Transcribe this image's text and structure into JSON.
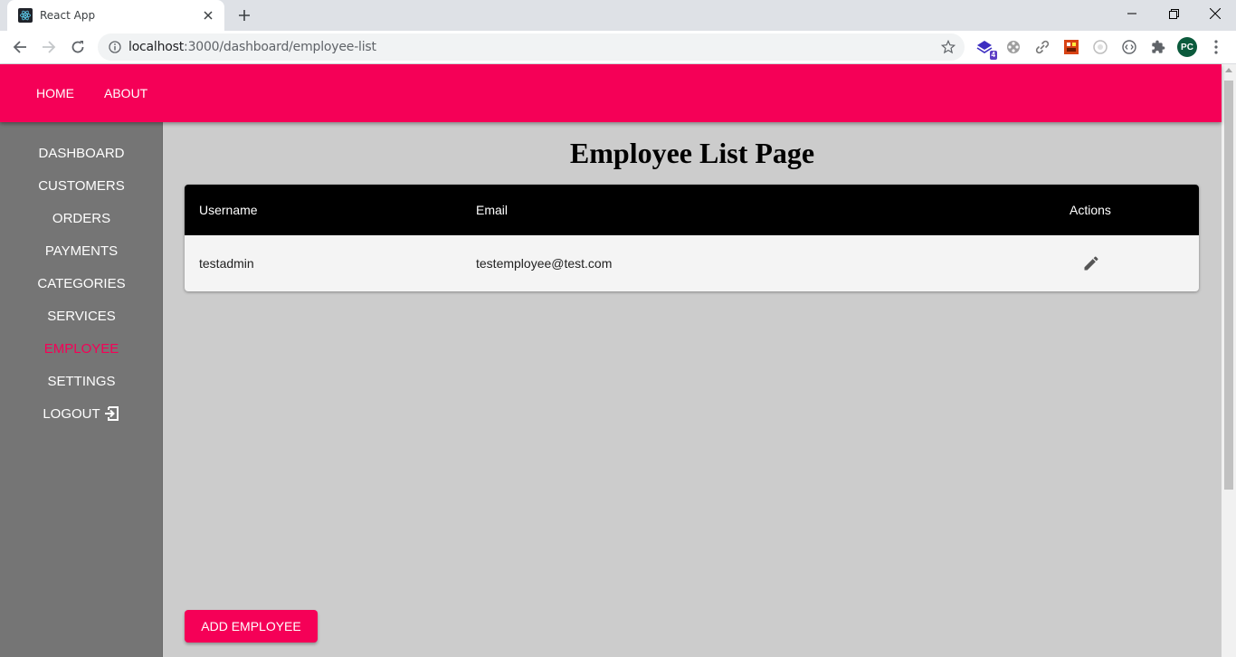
{
  "browser": {
    "tab_title": "React App",
    "url_host": "localhost",
    "url_rest": ":3000/dashboard/employee-list",
    "extension_badge": "4",
    "profile_initials": "PC"
  },
  "appbar": {
    "links": [
      "HOME",
      "ABOUT"
    ]
  },
  "sidebar": {
    "items": [
      {
        "label": "DASHBOARD"
      },
      {
        "label": "CUSTOMERS"
      },
      {
        "label": "ORDERS"
      },
      {
        "label": "PAYMENTS"
      },
      {
        "label": "CATEGORIES"
      },
      {
        "label": "SERVICES"
      },
      {
        "label": "EMPLOYEE"
      },
      {
        "label": "SETTINGS"
      },
      {
        "label": "LOGOUT"
      }
    ],
    "active": "EMPLOYEE"
  },
  "page": {
    "title": "Employee List Page",
    "table": {
      "columns": [
        "Username",
        "Email",
        "Actions"
      ],
      "rows": [
        {
          "username": "testadmin",
          "email": "testemployee@test.com",
          "action_icon": "edit-icon"
        }
      ]
    },
    "add_button_label": "ADD EMPLOYEE"
  },
  "colors": {
    "accent": "#f50057",
    "sidebar_bg": "#757575",
    "content_bg": "#cccccc",
    "table_header_bg": "#000000"
  }
}
